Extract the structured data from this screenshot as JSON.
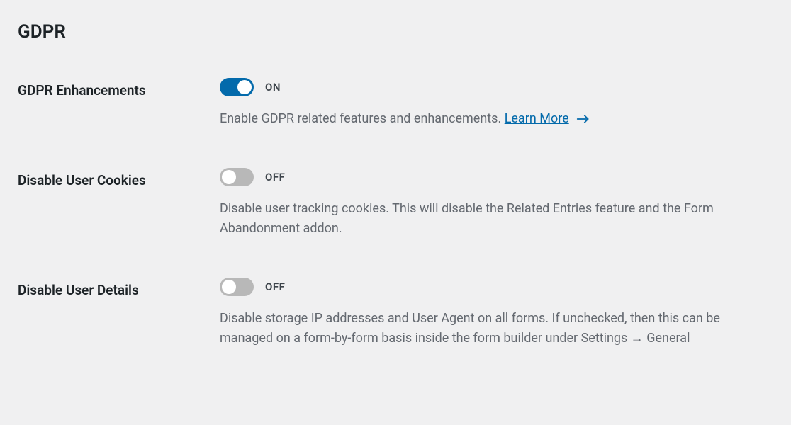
{
  "section_title": "GDPR",
  "settings": {
    "gdpr_enhancements": {
      "label": "GDPR Enhancements",
      "state": "ON",
      "enabled": true,
      "description": "Enable GDPR related features and enhancements.",
      "learn_more": "Learn More"
    },
    "disable_user_cookies": {
      "label": "Disable User Cookies",
      "state": "OFF",
      "enabled": false,
      "description": "Disable user tracking cookies. This will disable the Related Entries feature and the Form Abandonment addon."
    },
    "disable_user_details": {
      "label": "Disable User Details",
      "state": "OFF",
      "enabled": false,
      "description": "Disable storage IP addresses and User Agent on all forms. If unchecked, then this can be managed on a form-by-form basis inside the form builder under Settings → General"
    }
  },
  "colors": {
    "accent": "#036aab",
    "toggle_off": "#b8b8b8",
    "text_muted": "#646970"
  }
}
